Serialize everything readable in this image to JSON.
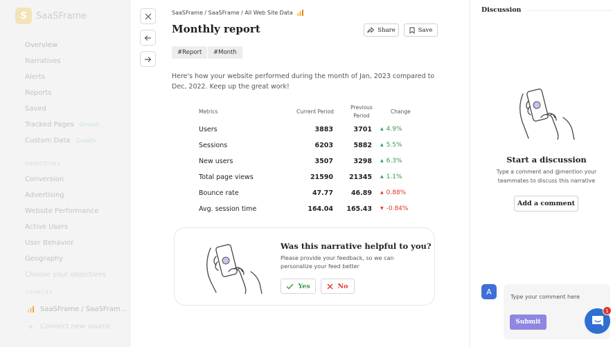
{
  "sidebar": {
    "logo_text": "SaaSFrame",
    "items": [
      {
        "label": "Overview"
      },
      {
        "label": "Narratives"
      },
      {
        "label": "Alerts"
      },
      {
        "label": "Reports"
      },
      {
        "label": "Saved"
      },
      {
        "label": "Tracked Pages",
        "badge": "Growth"
      },
      {
        "label": "Custom Data",
        "badge": "Growth"
      }
    ],
    "objectives_header": "OBJECTIVES",
    "objectives": [
      {
        "label": "Conversion"
      },
      {
        "label": "Advertising"
      },
      {
        "label": "Website Performance"
      },
      {
        "label": "Active Users"
      },
      {
        "label": "User Behavior"
      },
      {
        "label": "Geography"
      },
      {
        "label": "Choose your objectives"
      }
    ],
    "sources_header": "SOURCES",
    "source": "SaaSFrame / SaaSFram...",
    "connect": "Connect new source"
  },
  "report": {
    "breadcrumb": "SaaSFrame / SaaSFrame / All Web Site Data",
    "title": "Monthly report",
    "share_label": "Share",
    "save_label": "Save",
    "tags": [
      "#Report",
      "#Month"
    ],
    "intro": "Here's how your website performed during the month of Jan, 2023 compared to Dec, 2022. Keep up the great work!",
    "headers": {
      "metrics": "Metrics",
      "current": "Current Period",
      "previous": "Previous Period",
      "change": "Change"
    },
    "rows": [
      {
        "name": "Users",
        "current": "3883",
        "previous": "3701",
        "change": "4.9%",
        "dir": "up"
      },
      {
        "name": "Sessions",
        "current": "6203",
        "previous": "5882",
        "change": "5.5%",
        "dir": "up"
      },
      {
        "name": "New users",
        "current": "3507",
        "previous": "3298",
        "change": "6.3%",
        "dir": "up"
      },
      {
        "name": "Total page views",
        "current": "21590",
        "previous": "21345",
        "change": "1.1%",
        "dir": "up"
      },
      {
        "name": "Bounce rate",
        "current": "47.77",
        "previous": "46.89",
        "change": "0.88%",
        "dir": "up-bad"
      },
      {
        "name": "Avg. session time",
        "current": "164.04",
        "previous": "165.43",
        "change": "-0.84%",
        "dir": "down"
      }
    ],
    "feedback": {
      "title": "Was this narrative helpful to you?",
      "subtitle": "Please provide your feedback, so we can personalize your feed better",
      "yes_label": "Yes",
      "no_label": "No"
    }
  },
  "discussion": {
    "title": "Discussion",
    "heading": "Start a discussion",
    "text": "Type a comment and @mention your teammates to discuss this narrative",
    "add_comment_label": "Add a comment",
    "avatar_initial": "A",
    "comment_placeholder": "Type your comment here",
    "submit_label": "Submit",
    "chat_badge": "1"
  },
  "colors": {
    "accent": "#8e86e0",
    "up": "#3a9a4a",
    "down": "#e0362c",
    "chat": "#2f6fd2",
    "avatar": "#3f6fd8"
  }
}
